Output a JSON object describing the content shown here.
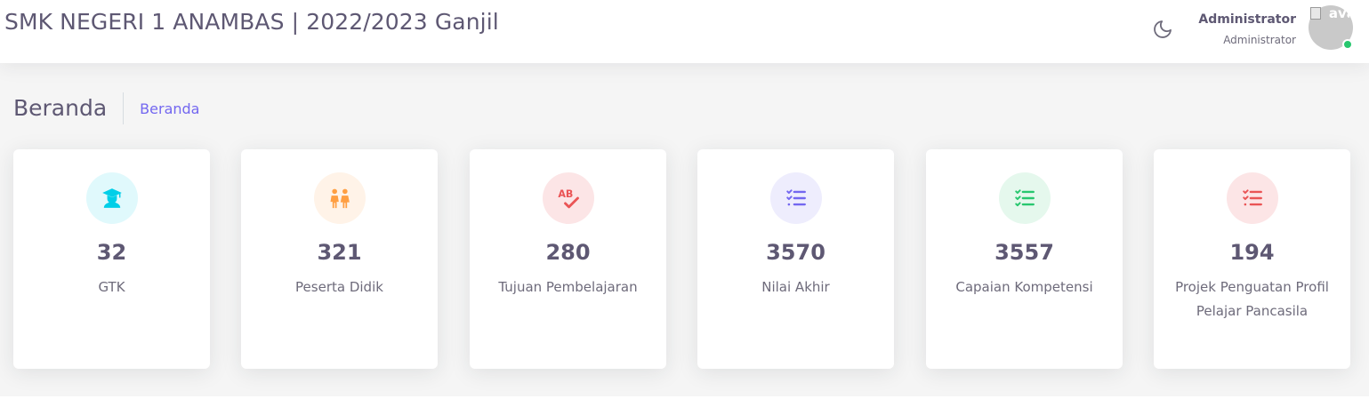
{
  "header": {
    "title": "SMK NEGERI 1 ANAMBAS | 2022/2023 Ganjil",
    "theme_icon": "moon-icon",
    "user": {
      "name": "Administrator",
      "role": "Administrator",
      "avatar_alt": "avatar",
      "status_color": "#28c76f"
    }
  },
  "breadcrumb": {
    "page_title": "Beranda",
    "items": [
      "Beranda"
    ]
  },
  "stats": [
    {
      "value": "32",
      "label": "GTK",
      "icon": "graduate-icon",
      "color": "#00cfe8",
      "bg": "#e0f9fc"
    },
    {
      "value": "321",
      "label": "Peserta Didik",
      "icon": "children-icon",
      "color": "#ff9f43",
      "bg": "#fff3e8"
    },
    {
      "value": "280",
      "label": "Tujuan Pembelajaran",
      "icon": "spellcheck-icon",
      "color": "#ea5455",
      "bg": "#fce5e6"
    },
    {
      "value": "3570",
      "label": "Nilai Akhir",
      "icon": "checklist-icon",
      "color": "#7367f0",
      "bg": "#eeedfd"
    },
    {
      "value": "3557",
      "label": "Capaian Kompetensi",
      "icon": "checklist-icon",
      "color": "#28c76f",
      "bg": "#e5f8ed"
    },
    {
      "value": "194",
      "label": "Projek Penguatan Profil Pelajar Pancasila",
      "icon": "checklist-icon",
      "color": "#ea5455",
      "bg": "#fce5e6"
    }
  ]
}
